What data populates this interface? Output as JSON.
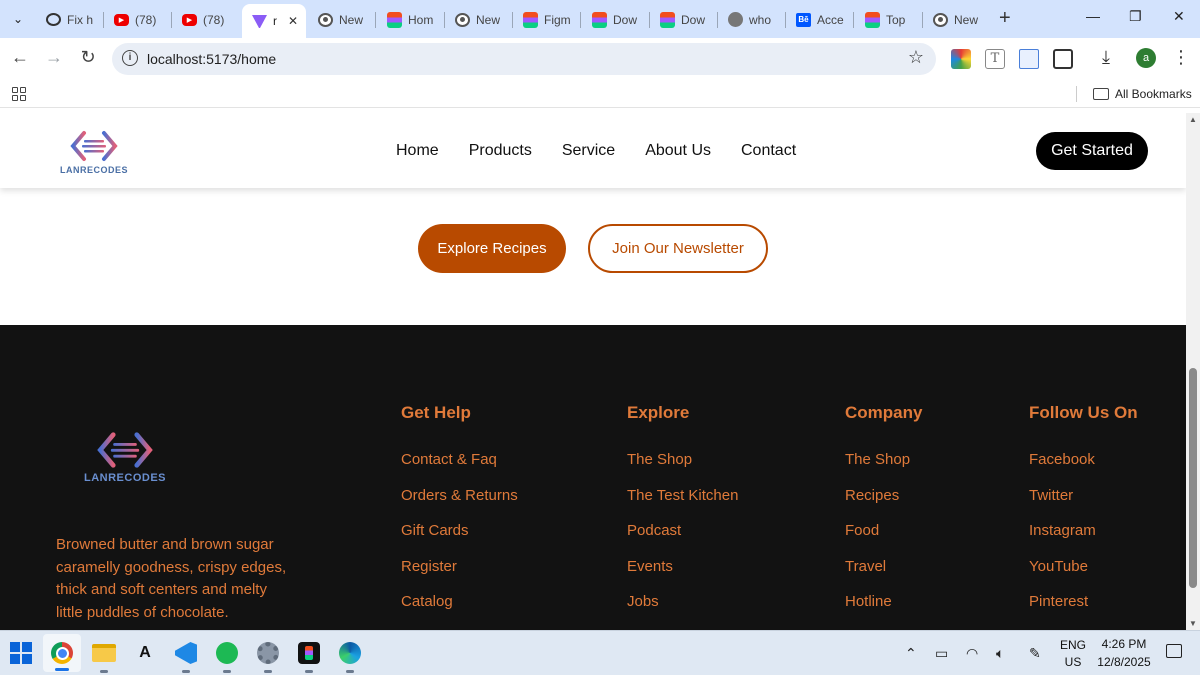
{
  "browser": {
    "tabs": [
      {
        "label": "Fix h",
        "icon": "chatgpt-icon",
        "active": false
      },
      {
        "label": "(78)",
        "icon": "youtube-icon",
        "active": false
      },
      {
        "label": "(78)",
        "icon": "youtube-icon",
        "active": false
      },
      {
        "label": "r",
        "icon": "vite-icon",
        "active": true
      },
      {
        "label": "New",
        "icon": "chrome-icon",
        "active": false
      },
      {
        "label": "Hom",
        "icon": "figma-icon",
        "active": false
      },
      {
        "label": "New",
        "icon": "chrome-icon",
        "active": false
      },
      {
        "label": "Figm",
        "icon": "figma-icon",
        "active": false
      },
      {
        "label": "Dow",
        "icon": "figma-icon",
        "active": false
      },
      {
        "label": "Dow",
        "icon": "figma-icon",
        "active": false
      },
      {
        "label": "who",
        "icon": "globe-icon",
        "active": false
      },
      {
        "label": "Acce",
        "icon": "behance-icon",
        "active": false
      },
      {
        "label": "Top",
        "icon": "figma-icon",
        "active": false
      },
      {
        "label": "New",
        "icon": "chrome-icon",
        "active": false
      }
    ],
    "close_tab_glyph": "✕",
    "new_tab_glyph": "+",
    "url": "localhost:5173/home",
    "bookmarks_label": "All Bookmarks",
    "profile_initial": "a",
    "behance_mark": "Bē"
  },
  "site": {
    "logo_text": "LANRECODES",
    "nav": [
      "Home",
      "Products",
      "Service",
      "About Us",
      "Contact"
    ],
    "cta_label": "Get Started",
    "explore_label": "Explore Recipes",
    "newsletter_label": "Join Our Newsletter"
  },
  "footer": {
    "logo_text": "LANRECODES",
    "description": "Browned butter and brown sugar caramelly goodness, crispy edges, thick and soft centers and melty little puddles of chocolate.",
    "columns": [
      {
        "title": "Get Help",
        "links": [
          "Contact & Faq",
          "Orders & Returns",
          "Gift Cards",
          "Register",
          "Catalog"
        ]
      },
      {
        "title": "Explore",
        "links": [
          "The Shop",
          "The Test Kitchen",
          "Podcast",
          "Events",
          "Jobs"
        ]
      },
      {
        "title": "Company",
        "links": [
          "The Shop",
          "Recipes",
          "Food",
          "Travel",
          "Hotline"
        ]
      },
      {
        "title": "Follow Us On",
        "links": [
          "Facebook",
          "Twitter",
          "Instagram",
          "YouTube",
          "Pinterest"
        ]
      }
    ]
  },
  "taskbar": {
    "apps": [
      "windows-start-icon",
      "chrome-icon",
      "file-explorer-icon",
      "a-app-icon",
      "vscode-icon",
      "spotify-icon",
      "settings-icon",
      "figma-icon",
      "edge-icon"
    ],
    "language": "ENG",
    "region": "US",
    "time": "4:26 PM",
    "date": "12/8/2025"
  },
  "colors": {
    "accent": "#b84a00",
    "footer_text": "#e07a3a",
    "footer_bg": "#121212",
    "tabstrip_bg": "#d3e3fd"
  }
}
